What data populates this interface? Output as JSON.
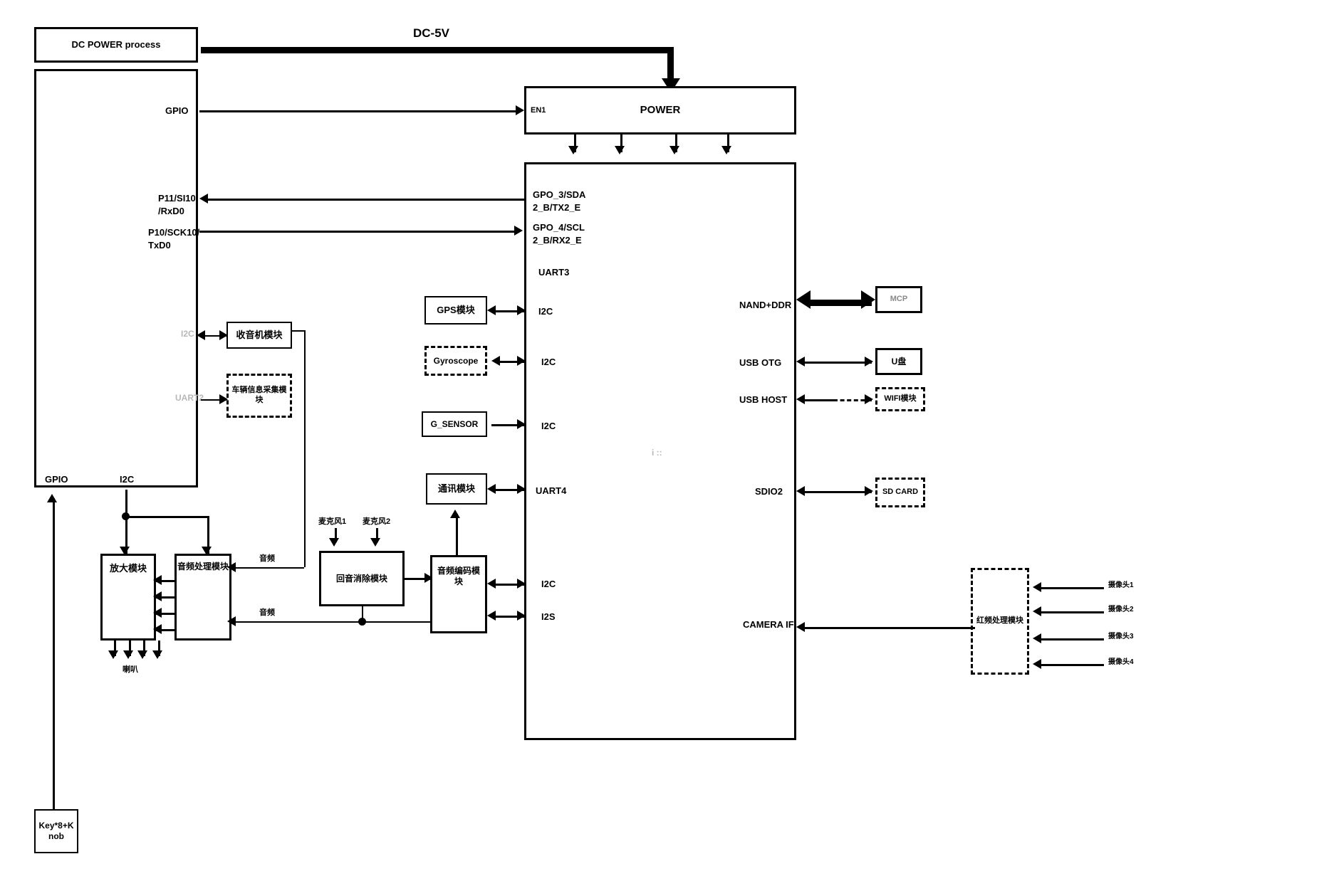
{
  "diagram": {
    "title_signal": "DC-5V",
    "chip_center_text": "i ::"
  },
  "blocks": {
    "dc_power": "DC POWER process",
    "mcu": "",
    "power": "POWER",
    "soc": "",
    "gps": "GPS模块",
    "gyroscope": "Gyroscope",
    "g_sensor": "G_SENSOR",
    "comm": "通讯模块",
    "radio": "收音机模块",
    "vehicle_info": "车辆信息采集模\n块",
    "amplifier": "放大模块",
    "audio_process": "音频处理模块",
    "echo_cancel": "回音消除模块",
    "audio_codec": "音频编码模\n块",
    "key_knob": "Key*8+K\nnob",
    "mcp": "MCP",
    "udisk": "U盘",
    "wifi": "WIFI模块",
    "sdcard": "SD CARD",
    "video_process": "红频处理模块"
  },
  "mcu_pins": {
    "gpio_top": "GPIO",
    "p11": "P11/SI10\n/RxD0",
    "p10": "P10/SCK10/\nTxD0",
    "i2c_mid": "I2C",
    "uart2": "UART2",
    "gpio_bottom": "GPIO",
    "i2c_bottom": "I2C"
  },
  "power_pins": {
    "en1": "EN1"
  },
  "soc_left_pins": [
    "GPO_3/SDA\n2_B/TX2_E",
    "GPO_4/SCL\n2_B/RX2_E",
    "UART3",
    "I2C",
    "I2C",
    "I2C",
    "UART4",
    "I2C",
    "I2S"
  ],
  "soc_right_pins": [
    "NAND+DDR",
    "USB OTG",
    "USB HOST",
    "SDIO2",
    "CAMERA IF"
  ],
  "misc_labels": {
    "mic1": "麦克风1",
    "mic2": "麦克风2",
    "speaker": "喇叭",
    "audio_out_1": "音频",
    "audio_out_2": "音频"
  },
  "cameras": [
    "摄像头1",
    "摄像头2",
    "摄像头3",
    "摄像头4"
  ],
  "colors": {
    "line": "#000000",
    "background": "#ffffff",
    "faint_text": "#b8b8b8"
  }
}
